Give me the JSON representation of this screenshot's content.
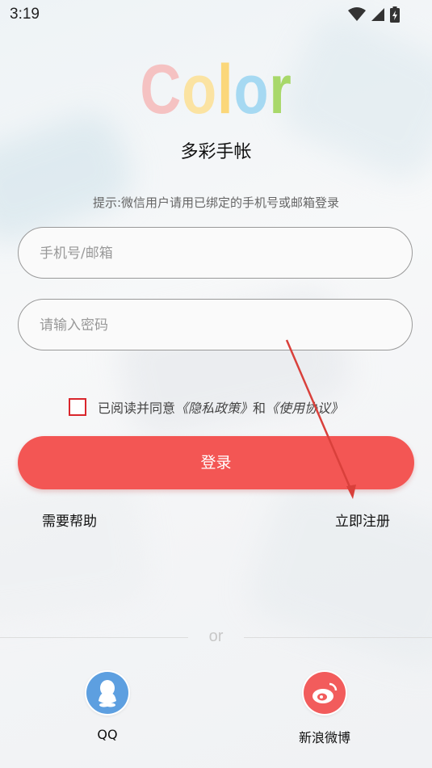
{
  "status_bar": {
    "time": "3:19",
    "icons": [
      "wifi-icon",
      "signal-icon",
      "battery-charging-icon"
    ]
  },
  "logo": {
    "letters": [
      "C",
      "o",
      "l",
      "o",
      "r"
    ],
    "colors": [
      "#f5c2c2",
      "#fbe6a0",
      "#fbd77a",
      "#a6d9f2",
      "#a8d86a"
    ]
  },
  "subtitle": "多彩手帐",
  "hint": "提示:微信用户请用已绑定的手机号或邮箱登录",
  "form": {
    "phone_placeholder": "手机号/邮箱",
    "password_placeholder": "请输入密码",
    "agree_prefix": "已阅读并同意",
    "privacy_policy": "《隐私政策》",
    "and": "和",
    "terms": "《使用协议》",
    "login_label": "登录"
  },
  "links": {
    "help": "需要帮助",
    "register": "立即注册"
  },
  "divider_text": "or",
  "social": [
    {
      "name": "QQ",
      "icon": "qq-icon",
      "color": "#5d9fe0"
    },
    {
      "name": "新浪微博",
      "icon": "weibo-icon",
      "color": "#f25c5c"
    }
  ],
  "accent_color": "#f35654"
}
